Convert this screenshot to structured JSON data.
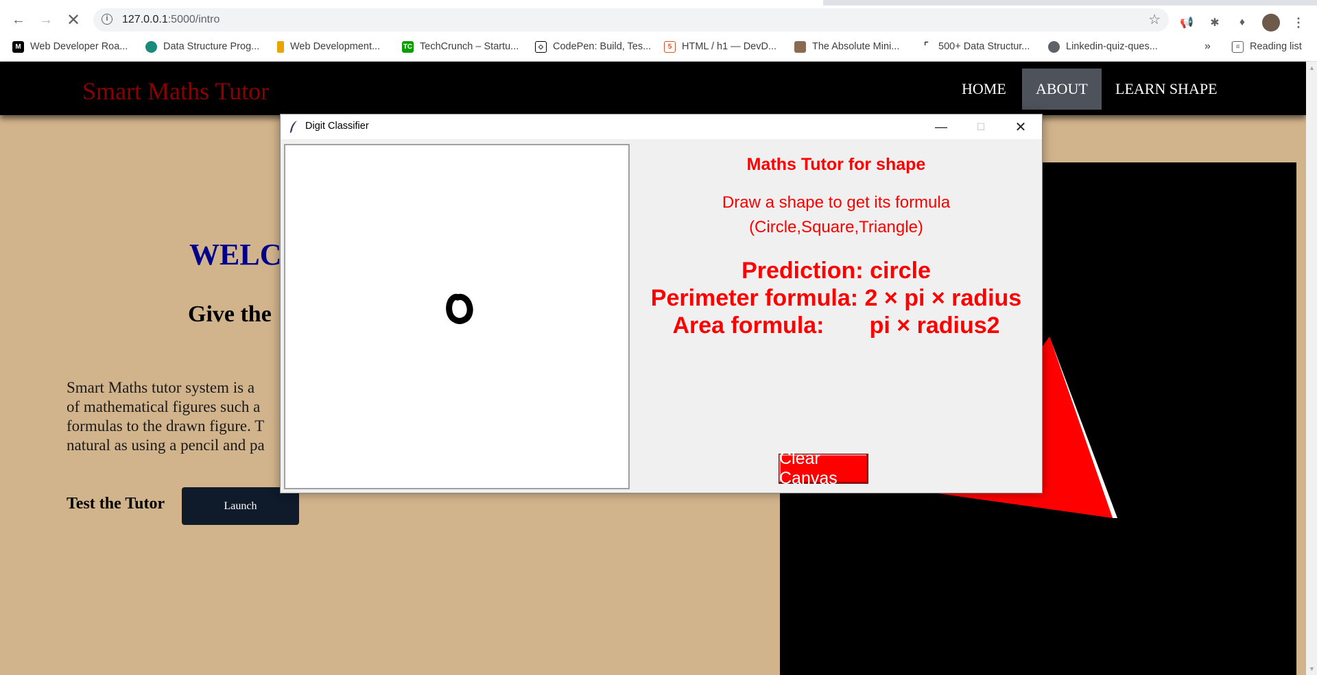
{
  "browser": {
    "url_host": "127.0.0.1",
    "url_path": ":5000/intro",
    "icons": {
      "back": "back-arrow-icon",
      "forward": "forward-arrow-icon",
      "stop": "stop-loading-icon",
      "info": "site-info-icon",
      "star": "bookmark-star-icon"
    },
    "extensions": [
      "megaphone-icon",
      "bug-icon",
      "puzzle-icon",
      "profile-avatar",
      "kebab-menu-icon"
    ],
    "bookmarks": [
      {
        "label": "Web Developer Roa...",
        "icon": "medium-logo-icon"
      },
      {
        "label": "Data Structure Prog...",
        "icon": "site-favicon-icon"
      },
      {
        "label": "Web Development...",
        "icon": "site-favicon-icon"
      },
      {
        "label": "TechCrunch – Startu...",
        "icon": "techcrunch-logo-icon"
      },
      {
        "label": "CodePen: Build, Tes...",
        "icon": "codepen-logo-icon"
      },
      {
        "label": "HTML / h1 — DevD...",
        "icon": "site-favicon-icon"
      },
      {
        "label": "The Absolute Mini...",
        "icon": "site-favicon-icon"
      },
      {
        "label": "500+ Data Structur...",
        "icon": "site-favicon-icon"
      },
      {
        "label": "Linkedin-quiz-ques...",
        "icon": "globe-icon"
      }
    ],
    "overflow_label": "»",
    "reading_list_label": "Reading list"
  },
  "site": {
    "brand": "Smart Maths Tutor",
    "nav": [
      {
        "label": "HOME",
        "active": false
      },
      {
        "label": "ABOUT",
        "active": true
      },
      {
        "label": "LEARN SHAPE",
        "active": false
      }
    ],
    "welcome_partial": "WELC",
    "subheading_partial": "Give the",
    "description_lines": [
      "Smart Maths tutor system is a",
      "of mathematical figures such a",
      "formulas to the drawn figure. T",
      "natural as using a pencil and pa"
    ],
    "test_label": "Test the Tutor",
    "launch_label": "Launch",
    "colors": {
      "background": "#d2b48c",
      "brand": "#8b0000",
      "welcome": "#00008b",
      "triangle": "#ff0000"
    }
  },
  "tk_window": {
    "title": "Digit Classifier",
    "heading": "Maths Tutor for shape",
    "instruction_line1": "Draw a shape to get its formula",
    "instruction_line2": "(Circle,Square,Triangle)",
    "prediction": "Prediction: circle",
    "perimeter": "Perimeter formula: 2 × pi × radius",
    "area": "Area formula:       pi × radius2",
    "clear_label": "Clear Canvas",
    "text_color": "#ff0000",
    "drawn_shape": "circle",
    "controls": {
      "minimize": "minimize-icon",
      "maximize": "maximize-icon",
      "close": "close-icon"
    }
  }
}
